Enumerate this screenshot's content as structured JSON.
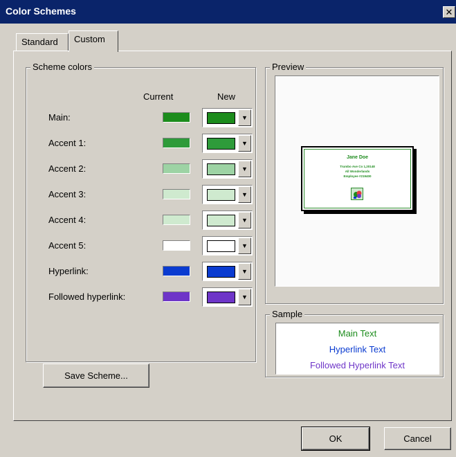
{
  "window": {
    "title": "Color Schemes",
    "close_glyph": "✕"
  },
  "tabs": [
    {
      "label": "Standard",
      "selected": false
    },
    {
      "label": "Custom",
      "selected": true
    }
  ],
  "scheme": {
    "group_label": "Scheme colors",
    "current_header": "Current",
    "new_header": "New",
    "rows": [
      {
        "label": "Main:",
        "current": "#1c8c1c",
        "new": "#1c8c1c"
      },
      {
        "label": "Accent 1:",
        "current": "#2e9b3a",
        "new": "#2e9b3a"
      },
      {
        "label": "Accent 2:",
        "current": "#9dd3a4",
        "new": "#9dd3a4"
      },
      {
        "label": "Accent 3:",
        "current": "#cfeacf",
        "new": "#cfeacf"
      },
      {
        "label": "Accent 4:",
        "current": "#cfeacf",
        "new": "#cfeacf"
      },
      {
        "label": "Accent 5:",
        "current": "#ffffff",
        "new": "#ffffff"
      },
      {
        "label": "Hyperlink:",
        "current": "#0a3bd0",
        "new": "#0a3bd0"
      },
      {
        "label": "Followed hyperlink:",
        "current": "#6e35c8",
        "new": "#6e35c8"
      }
    ],
    "save_button": "Save Scheme..."
  },
  "preview": {
    "group_label": "Preview",
    "slide_lines": [
      "Jane Doe",
      "Trumbo Ave Co 1,20148",
      "All Wonderlands",
      "Employee #219400"
    ],
    "slide_colors": [
      "#1c8c1c",
      "#e53c3c",
      "#6e35c8",
      "#0a3bd0"
    ]
  },
  "sample": {
    "group_label": "Sample",
    "main_text": "Main Text",
    "hyperlink_text": "Hyperlink Text",
    "followed_text": "Followed Hyperlink Text",
    "colors": {
      "main": "#1c8c1c",
      "hyperlink": "#0a3bd0",
      "followed": "#6e35c8"
    }
  },
  "buttons": {
    "ok": "OK",
    "cancel": "Cancel"
  }
}
